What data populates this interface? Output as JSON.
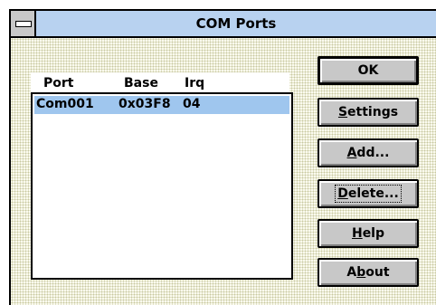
{
  "window": {
    "title": "COM Ports"
  },
  "list": {
    "columns": [
      "Port",
      "Base",
      "Irq"
    ],
    "rows": [
      {
        "port": "Com001",
        "base": "0x03F8",
        "irq": "04"
      }
    ]
  },
  "buttons": {
    "ok": {
      "pre": "OK",
      "mn": "",
      "post": ""
    },
    "settings": {
      "pre": "",
      "mn": "S",
      "post": "ettings"
    },
    "add": {
      "pre": "",
      "mn": "A",
      "post": "dd..."
    },
    "delete": {
      "pre": "",
      "mn": "D",
      "post": "elete..."
    },
    "help": {
      "pre": "",
      "mn": "H",
      "post": "elp"
    },
    "about": {
      "pre": "A",
      "mn": "b",
      "post": "out"
    }
  },
  "colors": {
    "titlebar": "#b8d2f0",
    "selection": "#9fc6ee",
    "button_face": "#c8c8c8"
  }
}
